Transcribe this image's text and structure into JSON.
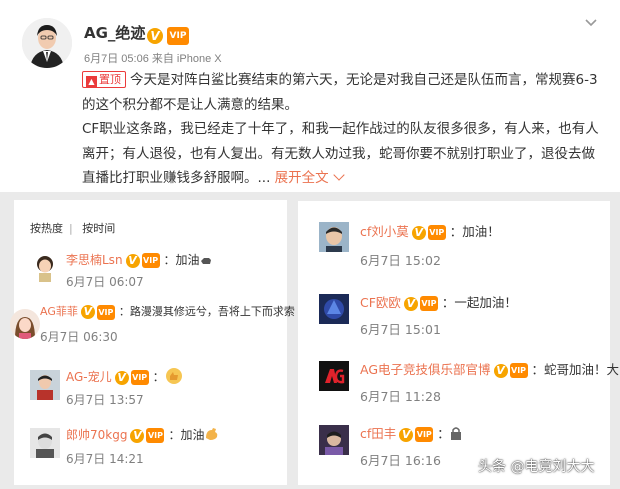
{
  "post": {
    "username": "AG_绝迹",
    "meta": "6月7日 05:06 来自 iPhone X",
    "pin_label": "置顶",
    "paragraph1": "今天是对阵白鲨比赛结束的第六天，无论是对我自己还是队伍而言，常规赛6-3的这个积分都不是让人满意的结果。",
    "paragraph2": "CF职业这条路，我已经走了十年了，和我一起作战过的队友很多很多，有人来，也有人离开；有人退役，也有人复出。有无数人劝过我，蛇哥你要不就别打职业了，退役去做直播比打职业赚钱多舒服啊。",
    "ellipsis": "...",
    "expand_label": "展开全文"
  },
  "badges": {
    "v": "V",
    "lvl": "VIP"
  },
  "comments_left": {
    "sort_hot": "按热度",
    "sort_sep": "|",
    "sort_time": "按时间",
    "items": [
      {
        "name": "李思楠Lsn",
        "text": "：加油",
        "time": "6月7日 06:07"
      },
      {
        "name": "AG菲菲",
        "text": "：路漫漫其修远兮，吾将上下而求索",
        "time": "6月7日 06:30"
      },
      {
        "name": "AG-宠儿",
        "text": "：",
        "time": "6月7日 13:57"
      },
      {
        "name": "郎帅70kgg",
        "text": "：加油",
        "time": "6月7日 14:21"
      }
    ]
  },
  "comments_right": {
    "items": [
      {
        "name": "cf刘小莫",
        "text": "：加油！",
        "time": "6月7日 15:02"
      },
      {
        "name": "CF欧欧",
        "text": "：一起加油！",
        "time": "6月7日 15:01"
      },
      {
        "name": "AG电子竞技俱乐部官博",
        "text": "：蛇哥加油！大",
        "time": "6月7日 11:28"
      },
      {
        "name": "cf田丰",
        "text": "：",
        "time": "6月7日 16:16"
      }
    ]
  },
  "watermark": "头条 @电竞刘大大",
  "colors": {
    "accent": "#eb7350",
    "pin": "#eb3b3b",
    "verified": "#f7a400"
  }
}
